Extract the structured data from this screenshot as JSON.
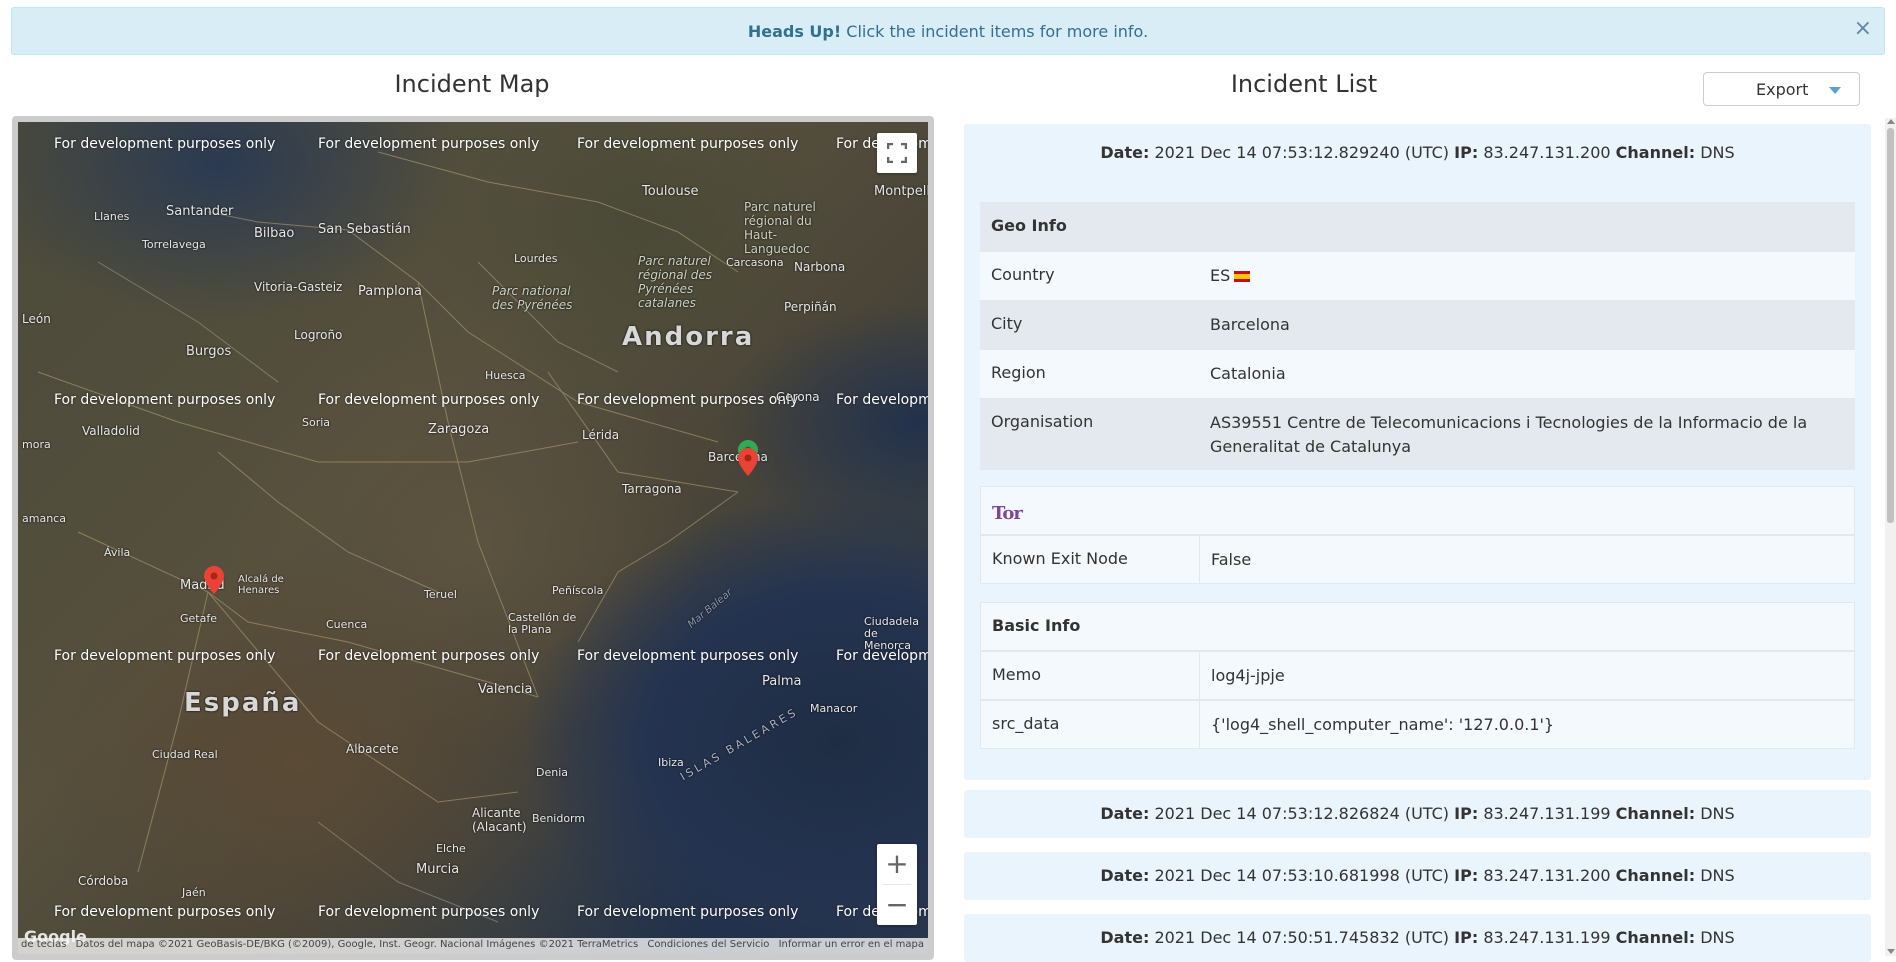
{
  "alert": {
    "strong": "Heads Up!",
    "text": "Click the incident items for more info.",
    "close": "×"
  },
  "map_section": {
    "title": "Incident Map",
    "watermark": "For development purposes only",
    "labels": {
      "andorra": "Andorra",
      "espana": "España",
      "toulouse": "Toulouse",
      "montpellier": "Montpellier",
      "santander": "Santander",
      "bilbao": "Bilbao",
      "san_sebastian": "San Sebastián",
      "torrelavega": "Torrelavega",
      "vitoria": "Vitoria-Gasteiz",
      "pamplona": "Pamplona",
      "leon": "León",
      "burgos": "Burgos",
      "logrono": "Logroño",
      "huesca": "Huesca",
      "perpinan": "Perpiñán",
      "narbona": "Narbona",
      "carcasona": "Carcasona",
      "lourdes": "Lourdes",
      "pn_pirineos": "Parc national des Pyrénées",
      "pn_catalan": "Parc naturel régional des Pyrénées catalanes",
      "pn_haut": "Parc naturel régional du Haut-Languedoc",
      "valladolid": "Valladolid",
      "soria": "Soria",
      "zaragoza": "Zaragoza",
      "lerida": "Lérida",
      "gerona": "Gerona",
      "barcelona": "Barcelona",
      "tarragona": "Tarragona",
      "avila": "Ávila",
      "madrid": "Madrid",
      "alcala": "Alcalá de Henares",
      "getafe": "Getafe",
      "teruel": "Teruel",
      "peniscola": "Peñíscola",
      "castellon": "Castellón de la Plana",
      "cuenca": "Cuenca",
      "valencia": "Valencia",
      "palma": "Palma",
      "manacor": "Manacor",
      "ciudadela": "Ciudadela de Menorca",
      "ciudad_real": "Ciudad Real",
      "albacete": "Albacete",
      "denia": "Denia",
      "ibiza": "Ibiza",
      "alicante": "Alicante (Alacant)",
      "benidorm": "Benidorm",
      "elche": "Elche",
      "murcia": "Murcia",
      "cordoba": "Córdoba",
      "jaen": "Jaén",
      "islas_baleares": "ISLAS BALEARES",
      "mar_balear": "Mar Balear",
      "salamanca": "amanca",
      "zamora": "mora",
      "llanes": "Llanes"
    },
    "attribution": {
      "shortcuts": "Combinaciones de teclas",
      "data": "Datos del mapa ©2021 GeoBasis-DE/BKG (©2009), Google, Inst. Geogr. Nacional Imágenes ©2021 TerraMetrics",
      "terms": "Condiciones del Servicio",
      "report": "Informar un error en el mapa"
    },
    "google": "Google",
    "zoom_in": "+",
    "zoom_out": "−"
  },
  "list_section": {
    "title": "Incident List",
    "export_label": "Export"
  },
  "labels": {
    "date": "Date:",
    "ip": "IP:",
    "channel": "Channel:"
  },
  "incidents": [
    {
      "date": "2021 Dec 14 07:53:12.829240 (UTC)",
      "ip": "83.247.131.200",
      "channel": "DNS",
      "expanded": true,
      "geo_info_title": "Geo Info",
      "country_label": "Country",
      "country": "ES",
      "city_label": "City",
      "city": "Barcelona",
      "region_label": "Region",
      "region": "Catalonia",
      "org_label": "Organisation",
      "org": "AS39551 Centre de Telecomunicacions i Tecnologies de la Informacio de la Generalitat de Catalunya",
      "tor_logo": "Tor",
      "exit_node_label": "Known Exit Node",
      "exit_node": "False",
      "basic_info_title": "Basic Info",
      "memo_label": "Memo",
      "memo": "log4j-jpje",
      "src_data_label": "src_data",
      "src_data": "{'log4_shell_computer_name': '127.0.0.1'}"
    },
    {
      "date": "2021 Dec 14 07:53:12.826824 (UTC)",
      "ip": "83.247.131.199",
      "channel": "DNS"
    },
    {
      "date": "2021 Dec 14 07:53:10.681998 (UTC)",
      "ip": "83.247.131.200",
      "channel": "DNS"
    },
    {
      "date": "2021 Dec 14 07:50:51.745832 (UTC)",
      "ip": "83.247.131.199",
      "channel": "DNS"
    }
  ],
  "colors": {
    "alert_bg": "#d9edf7",
    "alert_text": "#31708f",
    "incident_bg": "#eaf4fc",
    "marker_red": "#ea4335",
    "marker_green": "#34a853",
    "tor_purple": "#7d4698"
  }
}
